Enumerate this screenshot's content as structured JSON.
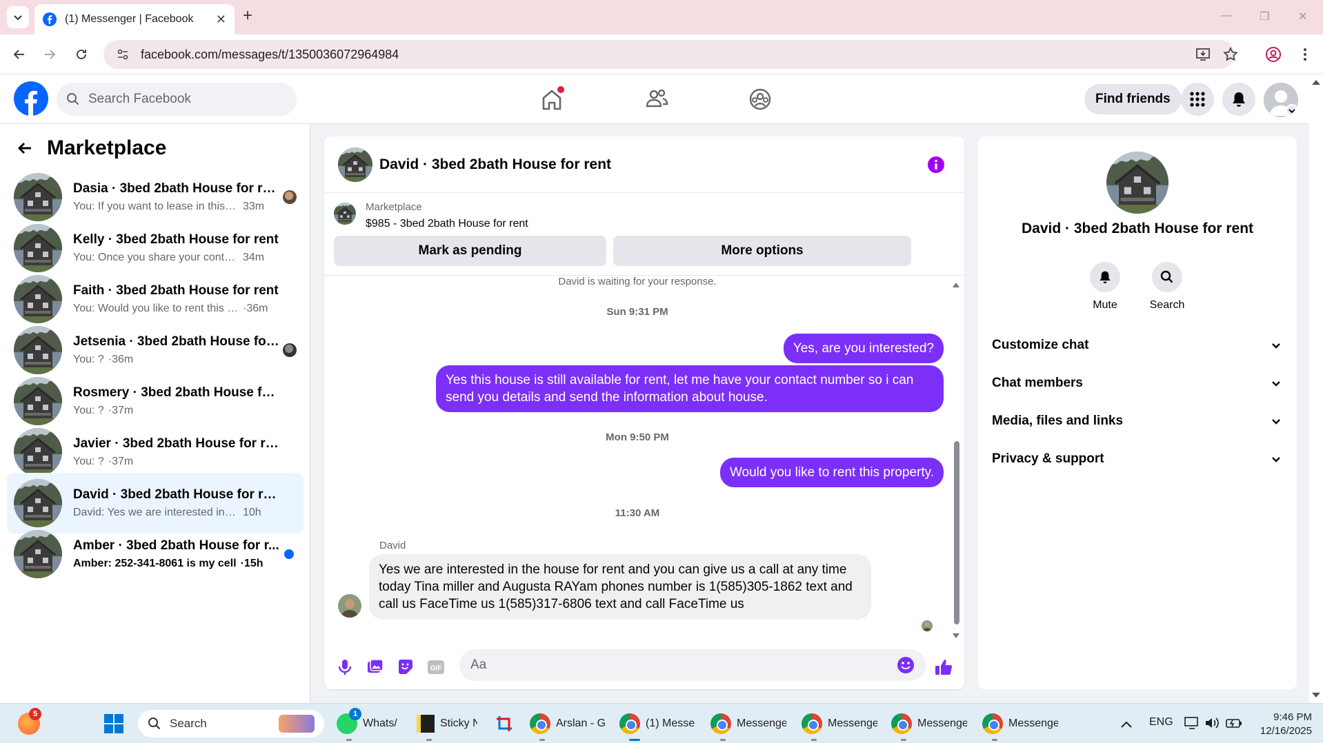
{
  "browser": {
    "tab_title": "(1) Messenger | Facebook",
    "url": "facebook.com/messages/t/1350036072964984"
  },
  "fb": {
    "search_placeholder": "Search Facebook",
    "find_friends": "Find friends",
    "brand_color": "#0866ff",
    "accent_purple": "#7b2ff7"
  },
  "left": {
    "title": "Marketplace",
    "conversations": [
      {
        "name": "Dasia · 3bed 2bath House for rent",
        "preview": "You: If you want to lease in this p...",
        "time": "33m",
        "unread": false
      },
      {
        "name": "Kelly · 3bed 2bath House for rent",
        "preview": "You: Once you share your contact n...",
        "time": "34m",
        "unread": false
      },
      {
        "name": "Faith · 3bed 2bath House for rent",
        "preview": "You: Would you like to rent this pro...",
        "time": "·36m",
        "unread": false
      },
      {
        "name": "Jetsenia · 3bed 2bath House for ...",
        "preview": "You: ?",
        "time": "·36m",
        "unread": false
      },
      {
        "name": "Rosmery · 3bed 2bath House for r...",
        "preview": "You: ?",
        "time": "·37m",
        "unread": false
      },
      {
        "name": "Javier · 3bed 2bath House for rent",
        "preview": "You: ?",
        "time": "·37m",
        "unread": false
      },
      {
        "name": "David · 3bed 2bath House for rent",
        "preview": "David: Yes we are interested in the h...",
        "time": "10h",
        "unread": false
      },
      {
        "name": "Amber · 3bed 2bath House for r...",
        "preview": "Amber: 252-341-8061 is my cell",
        "time": "·15h",
        "unread": true
      }
    ]
  },
  "chat": {
    "title": "David · 3bed 2bath House for rent",
    "marketplace_label": "Marketplace",
    "listing": "$985 - 3bed 2bath House for rent",
    "mark_pending": "Mark as pending",
    "more_options": "More options",
    "waiting": "David is waiting for your response.",
    "ts1": "Sun 9:31 PM",
    "out1": "Yes, are you interested?",
    "out2": "Yes this house is still available for rent, let me have your contact number so i can send you details and send the information about house.",
    "ts2": "Mon 9:50 PM",
    "out3": "Would you like to rent this property.",
    "ts3": "11:30 AM",
    "sender": "David",
    "in1": "Yes we are interested in the house for rent and you can give us a call at any time today Tina miller and Augusta RAYam phones number is 1(585)305-1862 text and call us FaceTime us 1(585)317-6806 text and call FaceTime us",
    "composer_placeholder": "Aa"
  },
  "right": {
    "title": "David · 3bed 2bath House for rent",
    "mute": "Mute",
    "search": "Search",
    "sections": [
      "Customize chat",
      "Chat members",
      "Media, files and links",
      "Privacy & support"
    ]
  },
  "taskbar": {
    "search": "Search",
    "apps": [
      "Whats/",
      "Sticky N",
      "Arslan - G",
      "(1) Messer",
      "Messenge",
      "Messenge",
      "Messenge",
      "Messenge"
    ],
    "badge_start": "5",
    "badge_whatsapp": "1",
    "lang": "ENG",
    "time": "9:46 PM",
    "date": "12/16/2025"
  }
}
